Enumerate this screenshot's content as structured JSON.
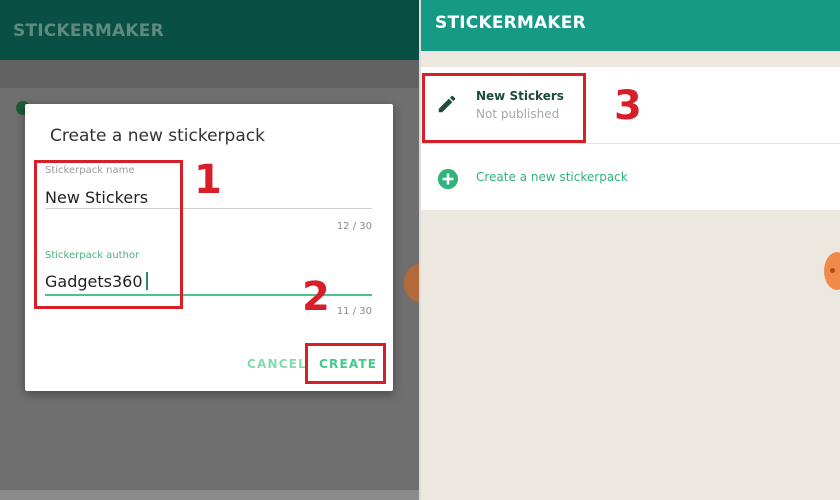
{
  "left": {
    "app_title": "STICKERMAKER",
    "dialog": {
      "title": "Create a new stickerpack",
      "name_label": "Stickerpack name",
      "name_value": "New Stickers",
      "name_counter": "12 / 30",
      "author_label": "Stickerpack author",
      "author_value": "Gadgets360",
      "author_counter": "11 / 30",
      "cancel_label": "CANCEL",
      "create_label": "CREATE"
    },
    "step_1": "1",
    "step_2": "2"
  },
  "right": {
    "app_title": "STICKERMAKER",
    "pack_item": {
      "title": "New Stickers",
      "subtitle": "Not published",
      "icon": "pencil-icon"
    },
    "new_pack_label": "Create a new stickerpack",
    "new_pack_icon": "plus-circle-icon",
    "step_3": "3"
  },
  "colors": {
    "accent_green": "#45c88c",
    "appbar_teal": "#169a86",
    "highlight_red": "#d81e29"
  }
}
